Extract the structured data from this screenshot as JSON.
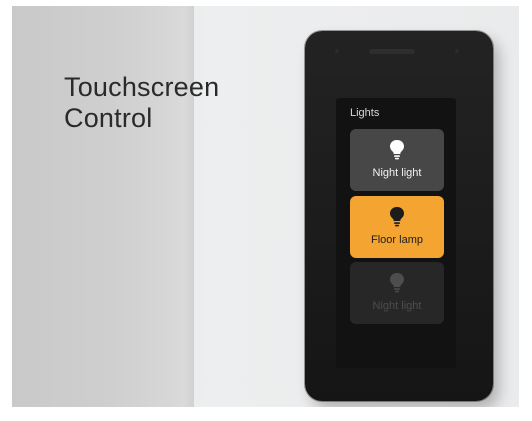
{
  "headline": {
    "line1": "Touchscreen",
    "line2": "Control"
  },
  "panel": {
    "title": "Lights",
    "tiles": [
      {
        "label": "Night light",
        "state": "on",
        "icon": "lightbulb-icon",
        "bg": "#474747",
        "bulb_color": "#ffffff"
      },
      {
        "label": "Floor lamp",
        "state": "selected",
        "icon": "lightbulb-icon",
        "bg": "#f4a431",
        "bulb_color": "#1c1c1c"
      },
      {
        "label": "Night light",
        "state": "off",
        "icon": "lightbulb-icon",
        "bg": "#272727",
        "bulb_color": "#4d4d4d"
      }
    ]
  },
  "colors": {
    "accent": "#f4a431",
    "device": "#1b1b1b"
  }
}
